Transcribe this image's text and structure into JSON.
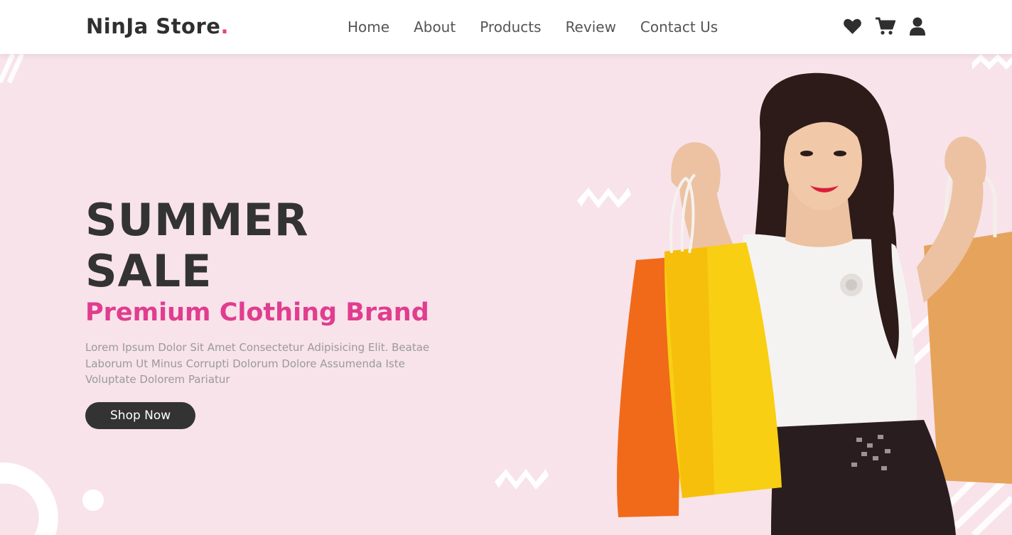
{
  "header": {
    "logo_text": "NinJa Store",
    "logo_dot": ".",
    "nav": [
      "Home",
      "About",
      "Products",
      "Review",
      "Contact Us"
    ],
    "icons": [
      "heart-icon",
      "cart-icon",
      "user-icon"
    ]
  },
  "hero": {
    "title": "SUMMER SALE",
    "subtitle": "Premium Clothing Brand",
    "description": "Lorem Ipsum Dolor Sit Amet Consectetur Adipisicing Elit. Beatae Laborum Ut Minus Corrupti Dolorum Dolore Assumenda Iste Voluptate Dolorem Pariatur",
    "button_label": "Shop Now",
    "image": "woman-holding-shopping-bags"
  },
  "colors": {
    "accent": "#e13d8f",
    "background": "#f8e3ea",
    "dark": "#333333",
    "text_muted": "#9a9a9a"
  }
}
